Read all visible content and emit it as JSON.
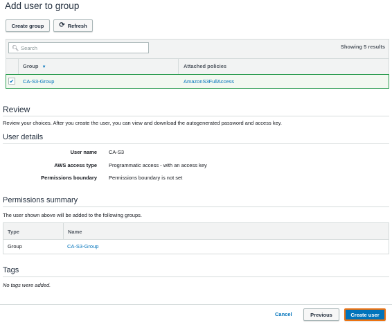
{
  "page": {
    "title": "Add user to group"
  },
  "toolbar": {
    "create_group_label": "Create group",
    "refresh_label": "Refresh"
  },
  "search": {
    "placeholder": "Search",
    "results_text": "Showing 5 results"
  },
  "groups_table": {
    "columns": [
      "Group",
      "Attached policies"
    ],
    "rows": [
      {
        "group": "CA-S3-Group",
        "policy": "AmazonS3FullAccess",
        "selected": true
      }
    ]
  },
  "review": {
    "heading": "Review",
    "description": "Review your choices. After you create the user, you can view and download the autogenerated password and access key."
  },
  "user_details": {
    "heading": "User details",
    "rows": [
      {
        "label": "User name",
        "value": "CA-S3"
      },
      {
        "label": "AWS access type",
        "value": "Programmatic access - with an access key"
      },
      {
        "label": "Permissions boundary",
        "value": "Permissions boundary is not set"
      }
    ]
  },
  "permissions_summary": {
    "heading": "Permissions summary",
    "description": "The user shown above will be added to the following groups.",
    "columns": [
      "Type",
      "Name"
    ],
    "rows": [
      {
        "type": "Group",
        "name": "CA-S3-Group"
      }
    ]
  },
  "tags": {
    "heading": "Tags",
    "empty_text": "No tags were added."
  },
  "footer": {
    "cancel_label": "Cancel",
    "previous_label": "Previous",
    "create_label": "Create user"
  },
  "colors": {
    "link": "#0073bb",
    "primary": "#0073bb",
    "selected_row_border": "#2e9d52"
  }
}
